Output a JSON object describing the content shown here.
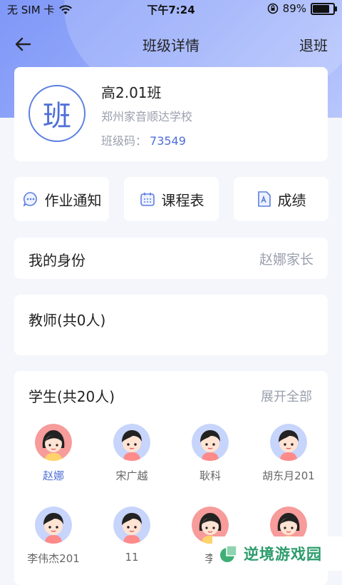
{
  "status_bar": {
    "carrier": "无 SIM 卡",
    "time": "下午7:24",
    "battery": "89%",
    "battery_level": 0.89
  },
  "nav": {
    "title": "班级详情",
    "quit_label": "退班"
  },
  "class_info": {
    "badge_char": "班",
    "name": "高2.01班",
    "school": "郑州家音顺达学校",
    "code_label": "班级码：",
    "code": "73549"
  },
  "actions": [
    {
      "label": "作业通知",
      "icon": "chat-bubble-icon"
    },
    {
      "label": "课程表",
      "icon": "calendar-icon"
    },
    {
      "label": "成绩",
      "icon": "report-icon"
    }
  ],
  "identity": {
    "label": "我的身份",
    "value": "赵娜家长"
  },
  "teachers": {
    "label": "教师(共0人)"
  },
  "students": {
    "label": "学生(共20人)",
    "expand_label": "展开全部",
    "list": [
      {
        "name": "赵娜",
        "avatar": "girl"
      },
      {
        "name": "宋广越",
        "avatar": "boy"
      },
      {
        "name": "耿科",
        "avatar": "boy"
      },
      {
        "name": "胡东月201",
        "avatar": "boy"
      },
      {
        "name": "李伟杰201",
        "avatar": "boy"
      },
      {
        "name": "11",
        "avatar": "boy"
      },
      {
        "name": "李",
        "avatar": "girl"
      },
      {
        "name": "",
        "avatar": "girl"
      }
    ]
  },
  "watermark": {
    "text": "逆境游戏园"
  },
  "colors": {
    "accent": "#4e6fd6",
    "hero": "#8ea3f8",
    "background": "#f4f6fb"
  }
}
